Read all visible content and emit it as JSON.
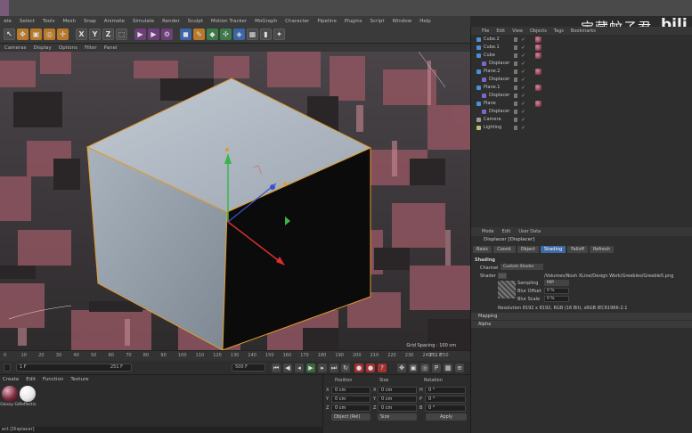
{
  "menubar": {
    "items": [
      "ate",
      "Select",
      "Tools",
      "Mesh",
      "Snap",
      "Animate",
      "Simulate",
      "Render",
      "Sculpt",
      "Motion Tracker",
      "MoGraph",
      "Character",
      "Pipeline",
      "Plugins",
      "Script",
      "Window",
      "Help"
    ]
  },
  "toolbar": {
    "icons": [
      "pointer-icon",
      "move-icon",
      "scale-icon",
      "rotate-icon",
      "move-axis-icon",
      "x-axis-icon",
      "y-axis-icon",
      "z-axis-icon",
      "world-coord-icon",
      "render-region-icon",
      "render-view-icon",
      "render-settings-icon",
      "cube-icon",
      "pen-icon",
      "subdivision-icon",
      "array-icon",
      "deformer-icon",
      "environment-icon",
      "camera-icon",
      "light-icon"
    ],
    "x_label": "X",
    "y_label": "Y",
    "z_label": "Z"
  },
  "viewport": {
    "menu": [
      "Cameras",
      "Display",
      "Options",
      "Filter",
      "Panel"
    ],
    "grid_spacing": "Grid Spacing : 100 cm"
  },
  "timeline": {
    "ticks": [
      "0",
      "10",
      "20",
      "30",
      "40",
      "50",
      "60",
      "70",
      "80",
      "90",
      "100",
      "110",
      "120",
      "130",
      "140",
      "150",
      "160",
      "170",
      "180",
      "190",
      "200",
      "210",
      "220",
      "230",
      "240",
      "250"
    ],
    "current_frame": "251 F"
  },
  "transport": {
    "start_field": "1 F",
    "mid_field": "251 F",
    "end_field": "500 F",
    "end_field_2": "251 F"
  },
  "material_manager": {
    "menu": [
      "Create",
      "Edit",
      "Function",
      "Texture"
    ],
    "materials": [
      {
        "name": "Glossy Gr",
        "color": "#7a2a3e"
      },
      {
        "name": "Reflectiv",
        "color": "#e8e8e8"
      }
    ]
  },
  "coordinates": {
    "headers": [
      "Position",
      "Size",
      "Rotation"
    ],
    "rows": [
      {
        "axis": "X",
        "pos": "0 cm",
        "size_axis": "X",
        "size": "0 cm",
        "rot_axis": "H",
        "rot": "0 °"
      },
      {
        "axis": "Y",
        "pos": "0 cm",
        "size_axis": "Y",
        "size": "0 cm",
        "rot_axis": "P",
        "rot": "0 °"
      },
      {
        "axis": "Z",
        "pos": "0 cm",
        "size_axis": "Z",
        "size": "0 cm",
        "rot_axis": "B",
        "rot": "0 °"
      }
    ],
    "mode_dropdown": "Object (Rel)",
    "size_dropdown": "Size",
    "apply_label": "Apply"
  },
  "object_manager": {
    "menu": [
      "File",
      "Edit",
      "View",
      "Objects",
      "Tags",
      "Bookmarks"
    ],
    "objects": [
      {
        "name": "Cube.2",
        "indent": 0,
        "type": "cube",
        "has_tag": true
      },
      {
        "name": "Cube.1",
        "indent": 0,
        "type": "cube",
        "has_tag": true
      },
      {
        "name": "Cube",
        "indent": 0,
        "type": "cube",
        "has_tag": true
      },
      {
        "name": "Displacer",
        "indent": 1,
        "type": "deformer",
        "has_tag": false
      },
      {
        "name": "Plane.2",
        "indent": 0,
        "type": "plane",
        "has_tag": true
      },
      {
        "name": "Displacer",
        "indent": 1,
        "type": "deformer",
        "has_tag": false
      },
      {
        "name": "Plane.1",
        "indent": 0,
        "type": "plane",
        "has_tag": true
      },
      {
        "name": "Displacer",
        "indent": 1,
        "type": "deformer",
        "has_tag": false
      },
      {
        "name": "Plane",
        "indent": 0,
        "type": "plane",
        "has_tag": true
      },
      {
        "name": "Displacer",
        "indent": 1,
        "type": "deformer",
        "has_tag": false
      },
      {
        "name": "Camera",
        "indent": 0,
        "type": "camera",
        "has_tag": false
      },
      {
        "name": "Lighting",
        "indent": 0,
        "type": "light",
        "has_tag": false
      }
    ]
  },
  "attributes": {
    "menu": [
      "Mode",
      "Edit",
      "User Data"
    ],
    "title": "Displacer [Displacer]",
    "tabs": [
      "Basic",
      "Coord.",
      "Object",
      "Shading",
      "Falloff",
      "Refresh"
    ],
    "active_tab": "Shading",
    "section": "Shading",
    "channel_label": "Channel",
    "channel_value": "Custom Shader",
    "shader_label": "Shader",
    "shader_path": "/Volumes/Nosh XLine/Design Work/Greebles/Greeble5.png",
    "sampling_label": "Sampling",
    "sampling_value": "MIP",
    "blur_offset_label": "Blur Offset",
    "blur_offset_value": "0 %",
    "blur_scale_label": "Blur Scale",
    "blur_scale_value": "0 %",
    "resolution": "Resolution 8192 x 8192, RGB (16 Bit), sRGB IEC61966-2.1",
    "sections_collapsed": [
      "Mapping",
      "Alpha"
    ]
  },
  "statusbar": {
    "text": "ect [Displacer]"
  },
  "watermark": {
    "text": "宝藏蚊子君",
    "logo": "bili"
  },
  "colors": {
    "accent_blue": "#3d6ba8",
    "selection_orange": "#e29a2c",
    "city_pink": "#9a5a64",
    "cube_gray": "#a9b3be"
  }
}
